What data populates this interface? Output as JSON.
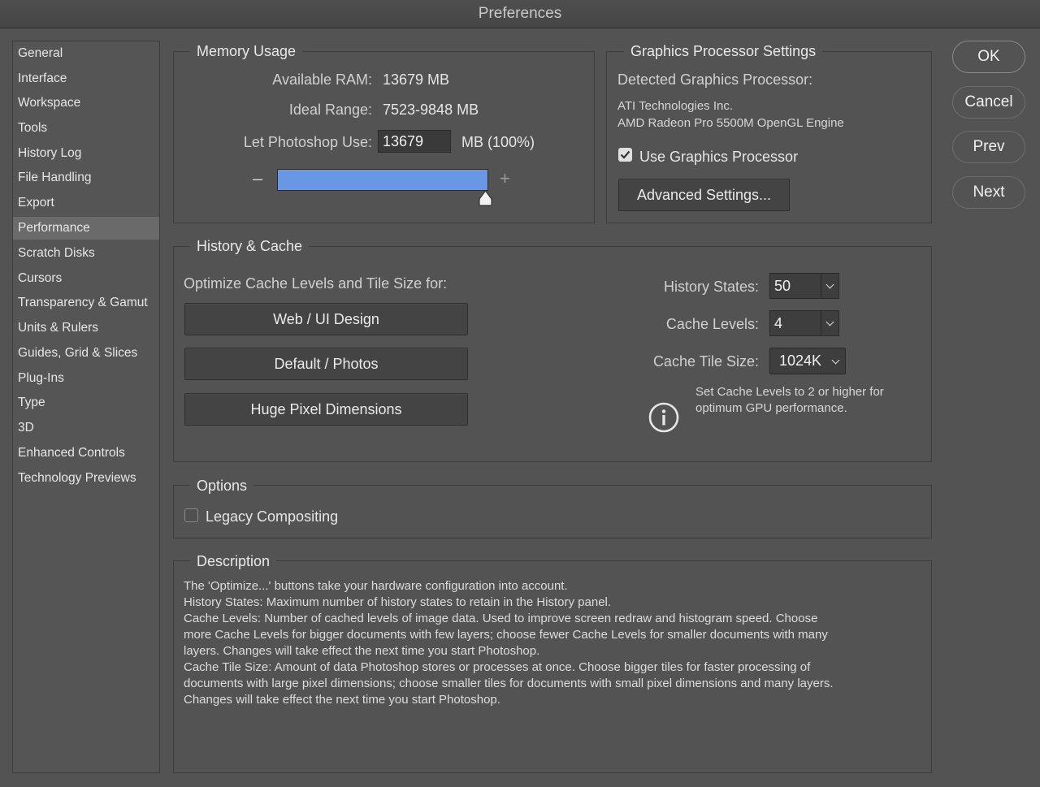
{
  "window": {
    "title": "Preferences"
  },
  "sidebar": {
    "items": [
      {
        "label": "General"
      },
      {
        "label": "Interface"
      },
      {
        "label": "Workspace"
      },
      {
        "label": "Tools"
      },
      {
        "label": "History Log"
      },
      {
        "label": "File Handling"
      },
      {
        "label": "Export"
      },
      {
        "label": "Performance"
      },
      {
        "label": "Scratch Disks"
      },
      {
        "label": "Cursors"
      },
      {
        "label": "Transparency & Gamut"
      },
      {
        "label": "Units & Rulers"
      },
      {
        "label": "Guides, Grid & Slices"
      },
      {
        "label": "Plug-Ins"
      },
      {
        "label": "Type"
      },
      {
        "label": "3D"
      },
      {
        "label": "Enhanced Controls"
      },
      {
        "label": "Technology Previews"
      }
    ],
    "selected": "Performance"
  },
  "memory": {
    "title": "Memory Usage",
    "available_label": "Available RAM:",
    "available_value": "13679 MB",
    "ideal_label": "Ideal Range:",
    "ideal_value": "7523-9848 MB",
    "use_label": "Let Photoshop Use:",
    "use_value": "13679",
    "use_unit": "MB (100%)",
    "minus": "–",
    "plus": "+",
    "slider_fraction": 1.0
  },
  "gpu": {
    "title": "Graphics Processor Settings",
    "detected_label": "Detected Graphics Processor:",
    "vendor": "ATI Technologies Inc.",
    "model": "AMD Radeon Pro 5500M OpenGL Engine",
    "use_label": "Use Graphics Processor",
    "use_checked": true,
    "advanced_button": "Advanced Settings..."
  },
  "history_cache": {
    "title": "History & Cache",
    "optimize_label": "Optimize Cache Levels and Tile Size for:",
    "buttons": [
      "Web / UI Design",
      "Default / Photos",
      "Huge Pixel Dimensions"
    ],
    "history_states_label": "History States:",
    "history_states_value": "50",
    "cache_levels_label": "Cache Levels:",
    "cache_levels_value": "4",
    "tile_size_label": "Cache Tile Size:",
    "tile_size_value": "1024K",
    "info_line1": "Set Cache Levels to 2 or higher for",
    "info_line2": "optimum GPU performance."
  },
  "options": {
    "title": "Options",
    "legacy_label": "Legacy Compositing",
    "legacy_checked": false
  },
  "description": {
    "title": "Description",
    "lines": [
      "The 'Optimize...' buttons take your hardware configuration into account.",
      "History States: Maximum number of history states to retain in the History panel.",
      "Cache Levels: Number of cached levels of image data.  Used to improve screen redraw and histogram speed.  Choose",
      "more Cache Levels for bigger documents with few layers; choose fewer Cache Levels for smaller documents with many",
      "layers. Changes will take effect the next time you start Photoshop.",
      "Cache Tile Size: Amount of data Photoshop stores or processes at once. Choose bigger tiles for faster processing of",
      "documents with large pixel dimensions; choose smaller tiles for documents with small pixel dimensions and many layers.",
      "Changes will take effect the next time you start Photoshop."
    ]
  },
  "actions": {
    "ok": "OK",
    "cancel": "Cancel",
    "prev": "Prev",
    "next": "Next"
  },
  "colors": {
    "background": "#535353",
    "slider_fill": "#6a97e5",
    "selected_item": "#6a6a6a"
  }
}
